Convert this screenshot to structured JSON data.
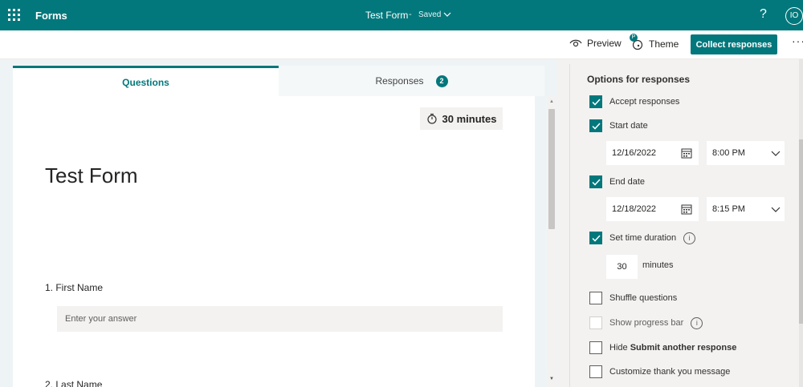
{
  "topbar": {
    "app_name": "Forms",
    "doc_title": "Test Form",
    "separator": "-",
    "status": "Saved",
    "help": "?",
    "avatar_initials": "IO"
  },
  "commandbar": {
    "preview_label": "Preview",
    "theme_label": "Theme",
    "theme_badge": "P",
    "collect_label": "Collect responses",
    "more_label": "···"
  },
  "tabs": {
    "questions_label": "Questions",
    "responses_label": "Responses",
    "responses_count": "2"
  },
  "form": {
    "timer_label": "30 minutes",
    "title": "Test Form",
    "questions": [
      {
        "label": "1. First Name",
        "placeholder": "Enter your answer"
      },
      {
        "label": "2. Last Name"
      }
    ]
  },
  "options": {
    "title": "Options for responses",
    "accept_responses": {
      "label": "Accept responses",
      "checked": true
    },
    "start_date": {
      "label": "Start date",
      "checked": true,
      "date": "12/16/2022",
      "time": "8:00 PM"
    },
    "end_date": {
      "label": "End date",
      "checked": true,
      "date": "12/18/2022",
      "time": "8:15 PM"
    },
    "set_time_duration": {
      "label": "Set time duration",
      "checked": true,
      "value": "30",
      "unit": "minutes"
    },
    "shuffle_questions": {
      "label": "Shuffle questions",
      "checked": false
    },
    "show_progress_bar": {
      "label": "Show progress bar",
      "checked": false,
      "disabled": true
    },
    "hide_submit": {
      "prefix": "Hide ",
      "bold": "Submit another response",
      "checked": false
    },
    "customize_thanks": {
      "label": "Customize thank you message",
      "checked": false
    }
  },
  "colors": {
    "accent": "#03787c",
    "panel_bg": "#f3f2f1",
    "form_bg": "#eef4f6"
  },
  "icons": [
    "app-launcher-icon",
    "chevron-down-icon",
    "help-icon",
    "eye-icon",
    "palette-icon",
    "more-icon",
    "timer-icon",
    "calendar-icon",
    "checkmark-icon",
    "info-icon"
  ]
}
